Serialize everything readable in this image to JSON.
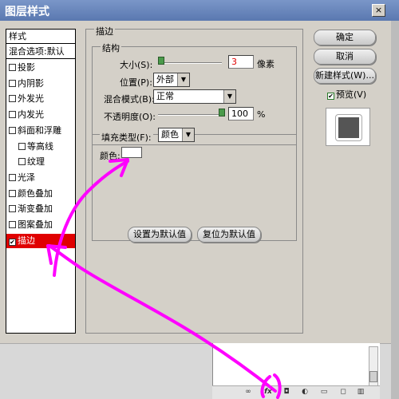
{
  "window": {
    "title": "图层样式",
    "close_glyph": "×"
  },
  "sidebar": {
    "header": "样式",
    "blend_options": "混合选项:默认",
    "items": [
      {
        "label": "投影",
        "checked": false,
        "indent": false
      },
      {
        "label": "内阴影",
        "checked": false,
        "indent": false
      },
      {
        "label": "外发光",
        "checked": false,
        "indent": false
      },
      {
        "label": "内发光",
        "checked": false,
        "indent": false
      },
      {
        "label": "斜面和浮雕",
        "checked": false,
        "indent": false
      },
      {
        "label": "等高线",
        "checked": false,
        "indent": true
      },
      {
        "label": "纹理",
        "checked": false,
        "indent": true
      },
      {
        "label": "光泽",
        "checked": false,
        "indent": false
      },
      {
        "label": "颜色叠加",
        "checked": false,
        "indent": false
      },
      {
        "label": "渐变叠加",
        "checked": false,
        "indent": false
      },
      {
        "label": "图案叠加",
        "checked": false,
        "indent": false
      },
      {
        "label": "描边",
        "checked": true,
        "indent": false,
        "selected": true
      }
    ]
  },
  "stroke": {
    "section_title": "描边",
    "structure_title": "结构",
    "size_label": "大小(S):",
    "size_value": "3",
    "size_unit": "像素",
    "position_label": "位置(P):",
    "position_value": "外部",
    "blend_label": "混合模式(B):",
    "blend_value": "正常",
    "opacity_label": "不透明度(O):",
    "opacity_value": "100",
    "opacity_unit": "%",
    "fill_type_label": "填充类型(F):",
    "fill_type_value": "颜色",
    "color_label": "颜色:",
    "color_value": "#ffffff",
    "size_slider_fraction": 0.02,
    "opacity_slider_fraction": 1.0
  },
  "buttons": {
    "set_default": "设置为默认值",
    "reset_default": "复位为默认值",
    "ok": "确定",
    "cancel": "取消",
    "new_style": "新建样式(W)...",
    "preview_label": "预览(V)",
    "preview_checked": true
  },
  "layers_palette": {
    "icons": [
      "link-icon",
      "fx-icon",
      "mask-icon",
      "adjustment-icon",
      "folder-icon",
      "new-layer-icon",
      "trash-icon"
    ]
  },
  "annotation": {
    "color": "#ff00ff"
  }
}
